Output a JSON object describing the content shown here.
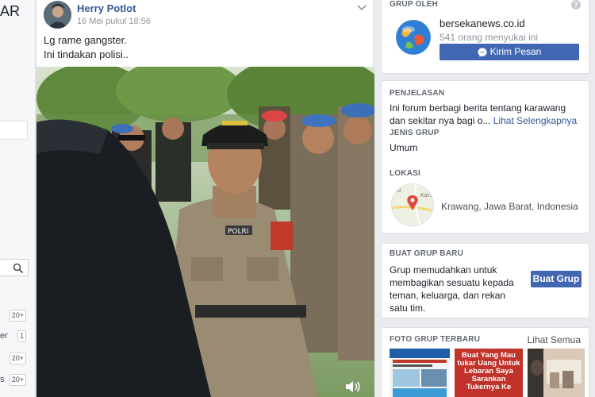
{
  "left_sidebar": {
    "title_fragment": "AR",
    "rows": [
      {
        "label": "",
        "count": "20+"
      },
      {
        "label": "er",
        "count": "1"
      },
      {
        "label": "",
        "count": "20+"
      },
      {
        "label": "s",
        "count": "20+"
      }
    ]
  },
  "post": {
    "author": "Herry Potlot",
    "date": "16 Mei pukul 18:56",
    "text": "Lg rame gangster.\nIni tindakan polisi..",
    "video_caption_uniform": "POLRI"
  },
  "group_by": {
    "heading": "GRUP OLEH",
    "page_name": "bersekanews.co.id",
    "likes": "541 orang menyukai ini",
    "button": "Kirim Pesan"
  },
  "about": {
    "heading_desc": "PENJELASAN",
    "desc": "Ini forum berbagi berita tentang karawang dan sekitar nya bagi o...",
    "see_more": "Lihat Selengkapnya",
    "heading_type": "JENIS GRUP",
    "type": "Umum",
    "heading_location": "LOKASI",
    "location": "Krawang, Jawa Barat, Indonesia"
  },
  "create_group": {
    "heading": "BUAT GRUP BARU",
    "text": "Grup memudahkan untuk membagikan sesuatu kepada teman, keluarga, dan rekan satu tim.",
    "button": "Buat Grup"
  },
  "photos": {
    "heading": "FOTO GRUP TERBARU",
    "see_all": "Lihat Semua",
    "photo2_text": "Buat Yang Mau tukar Uang Untuk Lebaran Saya Sarankan Tukernya Ke"
  },
  "colors": {
    "link": "#365899",
    "button": "#4267b2",
    "background": "#e9ebee"
  }
}
